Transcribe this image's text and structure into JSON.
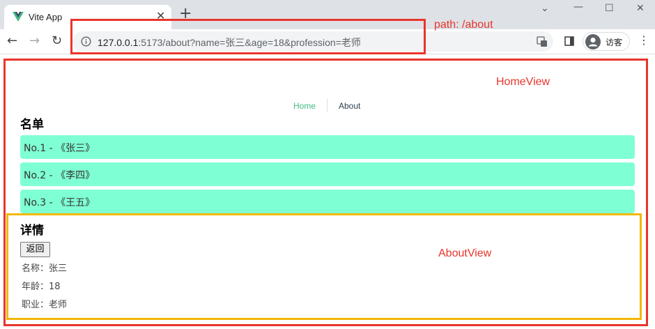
{
  "browser": {
    "tab_title": "Vite App",
    "url_host": "127.0.0.1",
    "url_rest": ":5173/about?name=张三&age=18&profession=老师",
    "profile_label": "访客"
  },
  "annotations": {
    "path_label": "path: /about",
    "home_label": "HomeView",
    "about_label": "AboutView",
    "red": "#e8352b",
    "yellow": "#f2b705"
  },
  "nav": {
    "home": "Home",
    "about": "About",
    "home_color": "#42b983"
  },
  "list": {
    "title": "名单",
    "items": [
      "No.1 - 《张三》",
      "No.2 - 《李四》",
      "No.3 - 《王五》"
    ],
    "item_color": "#7fffd4"
  },
  "detail": {
    "title": "详情",
    "back_label": "返回",
    "rows": [
      "名称：张三",
      "年龄：18",
      "职业：老师"
    ]
  }
}
